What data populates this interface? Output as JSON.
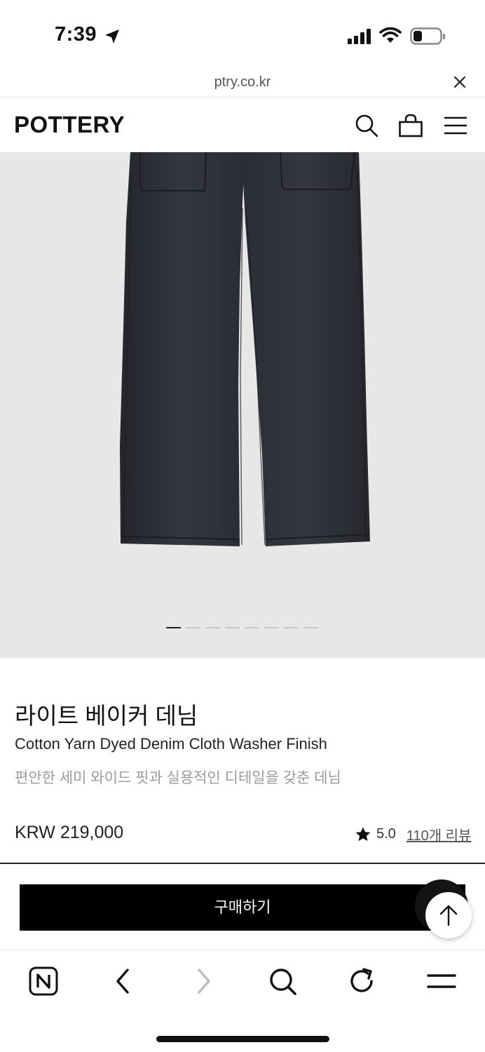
{
  "status_bar": {
    "time": "7:39"
  },
  "url_bar": {
    "domain": "ptry.co.kr"
  },
  "header": {
    "logo": "POTTERY"
  },
  "gallery": {
    "dot_count": 8,
    "active_index": 0
  },
  "product": {
    "title_ko": "라이트 베이커 데님",
    "subtitle_en": "Cotton Yarn Dyed Denim Cloth Washer Finish",
    "description_ko": "편안한 세미 와이드 핏과 실용적인 디테일을 갖춘 데님",
    "price": "KRW 219,000",
    "rating": "5.0",
    "reviews": "110개 리뷰"
  },
  "buy": {
    "label": "구매하기"
  },
  "colors": {
    "accent": "#000000",
    "image_bg": "#e7e7e7",
    "muted_text": "#9a9a9a"
  },
  "icons": [
    "location-arrow-icon",
    "signal-icon",
    "wifi-icon",
    "battery-icon",
    "close-icon",
    "search-icon",
    "shopping-bag-icon",
    "menu-icon",
    "star-icon",
    "arrow-up-icon",
    "naver-home-icon",
    "back-icon",
    "forward-icon",
    "reload-icon"
  ]
}
